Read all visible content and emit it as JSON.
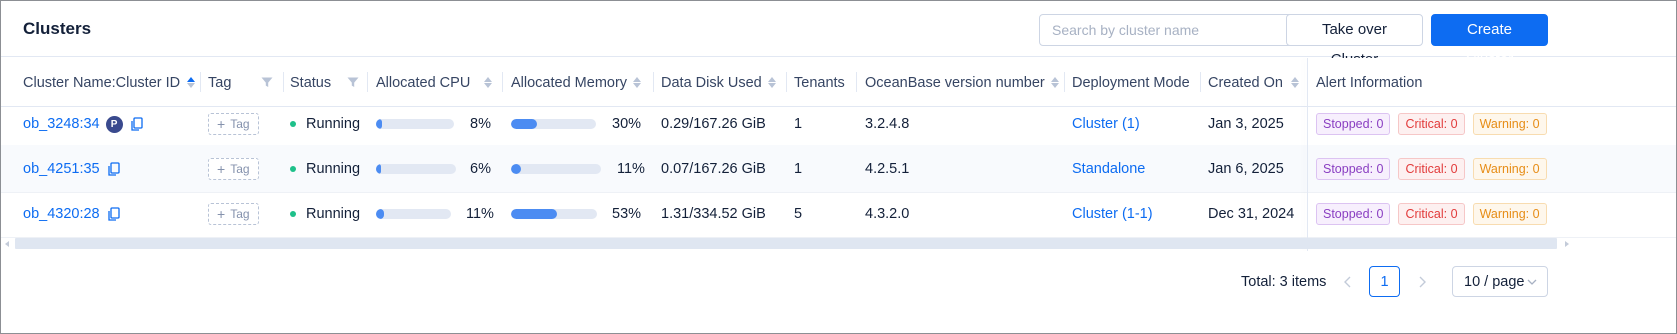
{
  "header": {
    "title": "Clusters",
    "search_placeholder": "Search by cluster name",
    "take_over_label": "Take over Cluster",
    "create_label": "Create Cluster"
  },
  "columns": {
    "name": "Cluster Name:Cluster ID",
    "tag": "Tag",
    "status": "Status",
    "cpu": "Allocated CPU",
    "memory": "Allocated Memory",
    "disk": "Data Disk Used",
    "tenants": "Tenants",
    "version": "OceanBase version number",
    "deployment": "Deployment Mode",
    "created": "Created On",
    "alert": "Alert Information"
  },
  "tag_button_label": "Tag",
  "rows": [
    {
      "name": "ob_3248:34",
      "primary_badge": "P",
      "status": "Running",
      "cpu_percent": 8,
      "cpu_label": "8%",
      "memory_percent": 30,
      "memory_label": "30%",
      "disk": "0.29/167.26 GiB",
      "tenants": "1",
      "version": "3.2.4.8",
      "deployment": "Cluster (1)",
      "created": "Jan 3, 2025",
      "alerts": {
        "stopped": "Stopped: 0",
        "critical": "Critical: 0",
        "warning": "Warning: 0"
      }
    },
    {
      "name": "ob_4251:35",
      "status": "Running",
      "cpu_percent": 6,
      "cpu_label": "6%",
      "memory_percent": 11,
      "memory_label": "11%",
      "disk": "0.07/167.26 GiB",
      "tenants": "1",
      "version": "4.2.5.1",
      "deployment": "Standalone",
      "created": "Jan 6, 2025",
      "alerts": {
        "stopped": "Stopped: 0",
        "critical": "Critical: 0",
        "warning": "Warning: 0"
      }
    },
    {
      "name": "ob_4320:28",
      "status": "Running",
      "cpu_percent": 11,
      "cpu_label": "11%",
      "memory_percent": 53,
      "memory_label": "53%",
      "disk": "1.31/334.52 GiB",
      "tenants": "5",
      "version": "4.3.2.0",
      "deployment": "Cluster (1-1)",
      "created": "Dec 31, 2024",
      "alerts": {
        "stopped": "Stopped: 0",
        "critical": "Critical: 0",
        "warning": "Warning: 0"
      }
    }
  ],
  "pagination": {
    "total": "Total: 3 items",
    "current_page": "1",
    "page_size": "10 / page"
  },
  "colors": {
    "primary": "#0d6cf2",
    "status_running": "#1ec08a",
    "bar_fill": "#4c8cf2"
  },
  "icons": [
    "search-icon",
    "sort-icon",
    "filter-icon",
    "copy-icon",
    "plus-icon",
    "chevron-left-icon",
    "chevron-right-icon",
    "chevron-down-icon"
  ]
}
